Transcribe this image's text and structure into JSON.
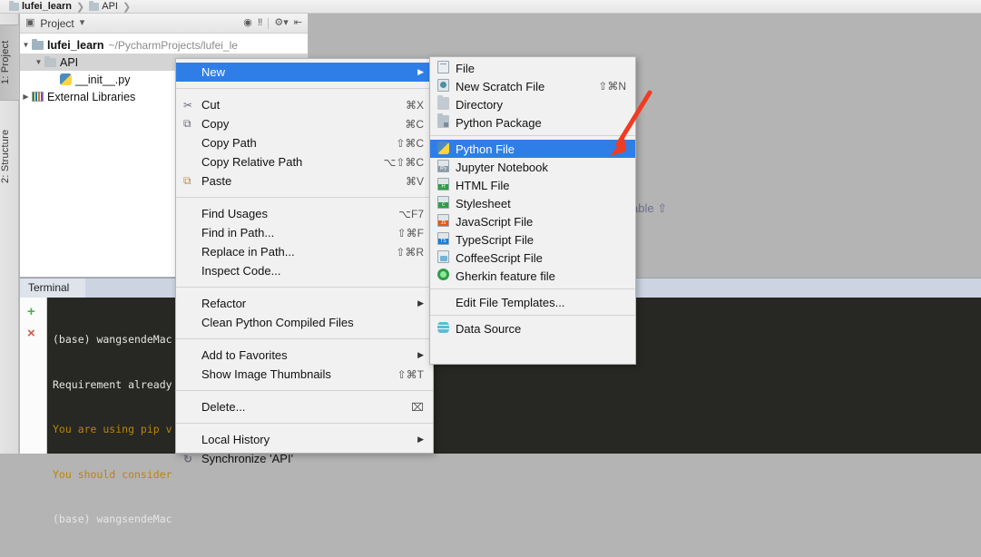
{
  "breadcrumb": {
    "items": [
      {
        "label": "lufei_learn",
        "icon": "folder-icon"
      },
      {
        "label": "API",
        "icon": "folder-icon"
      }
    ]
  },
  "left_strip": {
    "project_tab": "1: Project",
    "structure_tab": "2: Structure"
  },
  "project_panel": {
    "title": "Project",
    "toolbar_icons": [
      "target-icon",
      "collapse-all-icon",
      "gear-icon",
      "hide-icon"
    ],
    "tree": [
      {
        "label": "lufei_learn",
        "path": "~/PycharmProjects/lufei_le",
        "icon": "folder-icon",
        "expanded": true
      },
      {
        "label": "API",
        "path": "",
        "icon": "folder-icon",
        "expanded": true,
        "selected": true
      },
      {
        "label": "__init__.py",
        "path": "",
        "icon": "python-file-icon",
        "expanded": false
      },
      {
        "label": "External Libraries",
        "path": "",
        "icon": "libraries-icon",
        "expanded": false
      }
    ]
  },
  "editor": {
    "ghost_text": "able ⇧"
  },
  "context_menu": {
    "groups": [
      {
        "items": [
          {
            "label": "New",
            "shortcut": "",
            "submenu": true,
            "highlight": true,
            "icon": ""
          }
        ]
      },
      {
        "items": [
          {
            "label": "Cut",
            "shortcut": "⌘X",
            "icon": "scissors-icon"
          },
          {
            "label": "Copy",
            "shortcut": "⌘C",
            "icon": "copy-icon"
          },
          {
            "label": "Copy Path",
            "shortcut": "⇧⌘C",
            "icon": ""
          },
          {
            "label": "Copy Relative Path",
            "shortcut": "⌥⇧⌘C",
            "icon": ""
          },
          {
            "label": "Paste",
            "shortcut": "⌘V",
            "icon": "paste-icon"
          }
        ]
      },
      {
        "items": [
          {
            "label": "Find Usages",
            "shortcut": "⌥F7",
            "icon": ""
          },
          {
            "label": "Find in Path...",
            "shortcut": "⇧⌘F",
            "icon": ""
          },
          {
            "label": "Replace in Path...",
            "shortcut": "⇧⌘R",
            "icon": ""
          },
          {
            "label": "Inspect Code...",
            "shortcut": "",
            "icon": ""
          }
        ]
      },
      {
        "items": [
          {
            "label": "Refactor",
            "shortcut": "",
            "submenu": true,
            "icon": ""
          },
          {
            "label": "Clean Python Compiled Files",
            "shortcut": "",
            "icon": ""
          }
        ]
      },
      {
        "items": [
          {
            "label": "Add to Favorites",
            "shortcut": "",
            "submenu": true,
            "icon": ""
          },
          {
            "label": "Show Image Thumbnails",
            "shortcut": "⇧⌘T",
            "icon": ""
          }
        ]
      },
      {
        "items": [
          {
            "label": "Delete...",
            "shortcut": "⌧",
            "icon": ""
          }
        ]
      },
      {
        "items": [
          {
            "label": "Local History",
            "shortcut": "",
            "submenu": true,
            "icon": ""
          },
          {
            "label": "Synchronize 'API'",
            "shortcut": "",
            "icon": "sync-icon"
          }
        ]
      }
    ]
  },
  "submenu": {
    "groups": [
      {
        "items": [
          {
            "label": "File",
            "shortcut": "",
            "icon": "file-icon"
          },
          {
            "label": "New Scratch File",
            "shortcut": "⇧⌘N",
            "icon": "scratch-file-icon"
          },
          {
            "label": "Directory",
            "shortcut": "",
            "icon": "directory-icon"
          },
          {
            "label": "Python Package",
            "shortcut": "",
            "icon": "python-package-icon"
          }
        ]
      },
      {
        "items": [
          {
            "label": "Python File",
            "shortcut": "",
            "icon": "python-file-icon",
            "highlight": true
          },
          {
            "label": "Jupyter Notebook",
            "shortcut": "",
            "icon": "jupyter-icon"
          },
          {
            "label": "HTML File",
            "shortcut": "",
            "icon": "html-file-icon"
          },
          {
            "label": "Stylesheet",
            "shortcut": "",
            "icon": "css-file-icon"
          },
          {
            "label": "JavaScript File",
            "shortcut": "",
            "icon": "javascript-file-icon"
          },
          {
            "label": "TypeScript File",
            "shortcut": "",
            "icon": "typescript-file-icon"
          },
          {
            "label": "CoffeeScript File",
            "shortcut": "",
            "icon": "coffeescript-file-icon"
          },
          {
            "label": "Gherkin feature file",
            "shortcut": "",
            "icon": "gherkin-icon"
          }
        ]
      },
      {
        "items": [
          {
            "label": "Edit File Templates...",
            "shortcut": "",
            "icon": ""
          }
        ]
      },
      {
        "items": [
          {
            "label": "Data Source",
            "shortcut": "",
            "icon": "data-source-icon"
          }
        ]
      }
    ]
  },
  "terminal": {
    "tab_label": "Terminal",
    "lines": [
      {
        "text": "(base) wangsendeMac",
        "style": "normal"
      },
      {
        "text": "Requirement already",
        "style": "normal"
      },
      {
        "text": "You are using pip v",
        "style": "warn"
      },
      {
        "text": "You should consider",
        "style": "warn"
      },
      {
        "text": "(base) wangsendeMac",
        "style": "normal"
      }
    ],
    "add_button": "+",
    "close_button": "×"
  },
  "annotation": {
    "arrow_color": "#f03c22"
  }
}
